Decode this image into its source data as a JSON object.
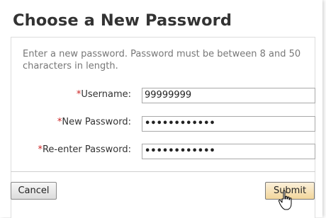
{
  "dialog": {
    "title": "Choose a New Password",
    "instructions": "Enter a new password. Password must be between 8 and 50 characters in length."
  },
  "form": {
    "required_marker": "*",
    "username_label": "Username:",
    "username_value": "99999999",
    "new_password_label": "New Password:",
    "new_password_masked": "••••••••••••",
    "reenter_password_label": "Re-enter Password:",
    "reenter_password_masked": "••••••••••••"
  },
  "buttons": {
    "cancel": "Cancel",
    "submit": "Submit"
  },
  "colors": {
    "required": "#cc2222",
    "title": "#333333",
    "submit_bg": "#f2d69b"
  },
  "icons": {
    "cursor": "hand-pointer-icon"
  }
}
